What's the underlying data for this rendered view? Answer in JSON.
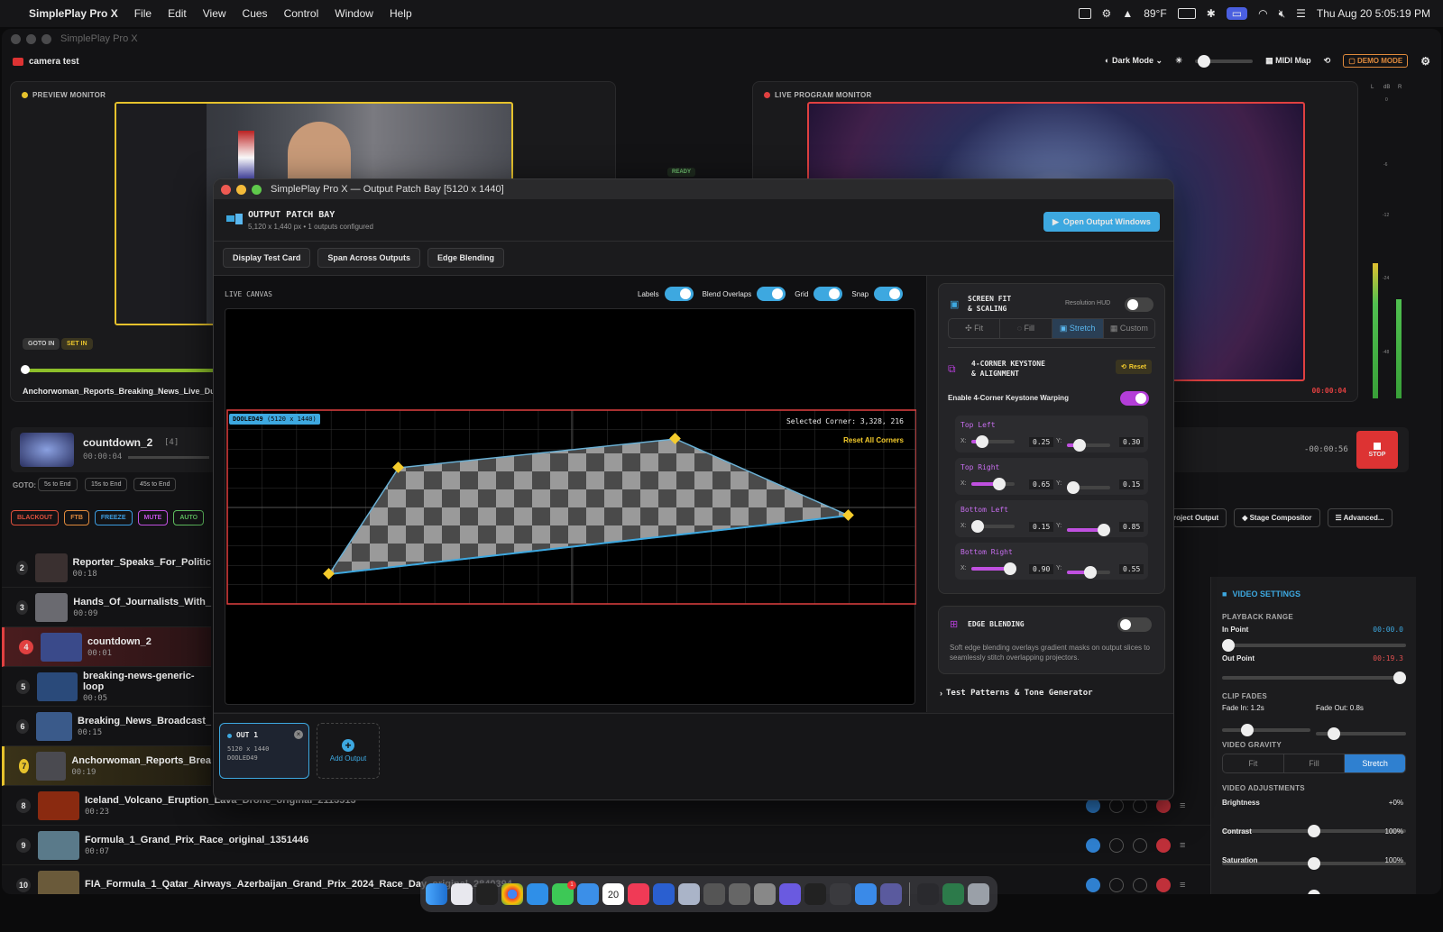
{
  "menubar": {
    "app": "SimplePlay Pro X",
    "menus": [
      "File",
      "Edit",
      "View",
      "Cues",
      "Control",
      "Window",
      "Help"
    ],
    "weather": "89°F",
    "datetime": "Thu Aug 20  5:05:19 PM"
  },
  "window": {
    "title": "SimplePlay Pro X",
    "project": "camera test",
    "theme_label": "Dark Mode",
    "midi_label": "MIDI Map",
    "demo_label": "DEMO MODE"
  },
  "preview": {
    "label": "PREVIEW MONITOR",
    "goto_in": "GOTO IN",
    "set_in": "SET IN",
    "clip_name": "Anchorwoman_Reports_Breaking_News_Live_During"
  },
  "program": {
    "label": "LIVE PROGRAM MONITOR",
    "ready": "READY",
    "timecode": "00:00:04"
  },
  "meter": {
    "labels": [
      "L",
      "dB",
      "R"
    ],
    "ticks": [
      "0",
      "-6",
      "-12",
      "-24",
      "-48"
    ]
  },
  "now_playing": {
    "title": "countdown_2",
    "count": "[4]",
    "time": "00:00:04",
    "remaining": "-00:00:56",
    "stop": "STOP",
    "goto_label": "GOTO:",
    "goto_buttons": [
      "5s to End",
      "15s to End",
      "45s to End"
    ]
  },
  "fx_buttons": [
    {
      "label": "BLACKOUT",
      "color": "#e0503c"
    },
    {
      "label": "FTB",
      "color": "#e08a3c"
    },
    {
      "label": "FREEZE",
      "color": "#3c9ce0"
    },
    {
      "label": "MUTE",
      "color": "#c050e0"
    },
    {
      "label": "AUTO",
      "color": "#60c060"
    }
  ],
  "right_tools": [
    "roject Output",
    "Stage Compositor",
    "Advanced..."
  ],
  "cues": [
    {
      "num": "2",
      "title": "Reporter_Speaks_For_Politic",
      "time": "00:18"
    },
    {
      "num": "3",
      "title": "Hands_Of_Journalists_With_",
      "time": "00:09"
    },
    {
      "num": "4",
      "title": "countdown_2",
      "time": "00:01"
    },
    {
      "num": "5",
      "title": "breaking-news-generic-loop",
      "time": "00:05"
    },
    {
      "num": "6",
      "title": "Breaking_News_Broadcast_",
      "time": "00:15"
    },
    {
      "num": "7",
      "title": "Anchorwoman_Reports_Brea",
      "time": "00:19"
    },
    {
      "num": "8",
      "title": "Iceland_Volcano_Eruption_Lava_Drone_original_2113513",
      "time": "00:23"
    },
    {
      "num": "9",
      "title": "Formula_1_Grand_Prix_Race_original_1351446",
      "time": "00:07"
    },
    {
      "num": "10",
      "title": "FIA_Formula_1_Qatar_Airways_Azerbaijan_Grand_Prix_2024_Race_Day_original_2840394",
      "time": ""
    }
  ],
  "dialog": {
    "title": "SimplePlay Pro X — Output Patch Bay [5120 x 1440]",
    "header": "OUTPUT PATCH BAY",
    "subheader": "5,120 x 1,440 px  •  1 outputs configured",
    "open_button": "Open Output Windows",
    "tabs": [
      "Display Test Card",
      "Span Across Outputs",
      "Edge Blending"
    ],
    "canvas_label": "LIVE CANVAS",
    "toggles": [
      "Labels",
      "Blend Overlaps",
      "Grid",
      "Snap"
    ],
    "display_tag": "DOOLED49",
    "display_res": "(5120 x 1440)",
    "selected_corner": "Selected Corner: 3,328, 216",
    "reset_corners": "Reset All Corners",
    "output": {
      "name": "OUT 1",
      "res": "5120 x 1440",
      "device": "DOOLED49"
    },
    "add_output": "Add Output"
  },
  "screen_fit": {
    "title1": "SCREEN FIT",
    "title2": "& SCALING",
    "hud_label": "Resolution HUD",
    "modes": [
      "Fit",
      "Fill",
      "Stretch",
      "Custom"
    ],
    "active_mode": "Stretch"
  },
  "keystone": {
    "title1": "4-CORNER KEYSTONE",
    "title2": "& ALIGNMENT",
    "reset": "Reset",
    "enable_label": "Enable 4-Corner Keystone Warping",
    "corners": [
      {
        "name": "Top Left",
        "x": "0.25",
        "y": "0.30"
      },
      {
        "name": "Top Right",
        "x": "0.65",
        "y": "0.15"
      },
      {
        "name": "Bottom Left",
        "x": "0.15",
        "y": "0.85"
      },
      {
        "name": "Bottom Right",
        "x": "0.90",
        "y": "0.55"
      }
    ]
  },
  "edge_blending": {
    "title": "EDGE BLENDING",
    "desc": "Soft edge blending overlays gradient masks on output slices to seamlessly stitch overlapping projectors."
  },
  "test_patterns": "Test Patterns & Tone Generator",
  "video_settings": {
    "title": "VIDEO SETTINGS",
    "playback_range": "PLAYBACK RANGE",
    "in_label": "In Point",
    "in_value": "00:00.0",
    "out_label": "Out Point",
    "out_value": "00:19.3",
    "clip_fades": "CLIP FADES",
    "fade_in": "Fade In: 1.2s",
    "fade_out": "Fade Out: 0.8s",
    "gravity": "VIDEO GRAVITY",
    "gravity_modes": [
      "Fit",
      "Fill",
      "Stretch"
    ],
    "adjustments": "VIDEO ADJUSTMENTS",
    "brightness": "Brightness",
    "brightness_val": "+0%",
    "contrast": "Contrast",
    "contrast_val": "100%",
    "saturation": "Saturation",
    "saturation_val": "100%"
  },
  "dock": {
    "calendar_day": "20",
    "badge": "1"
  }
}
